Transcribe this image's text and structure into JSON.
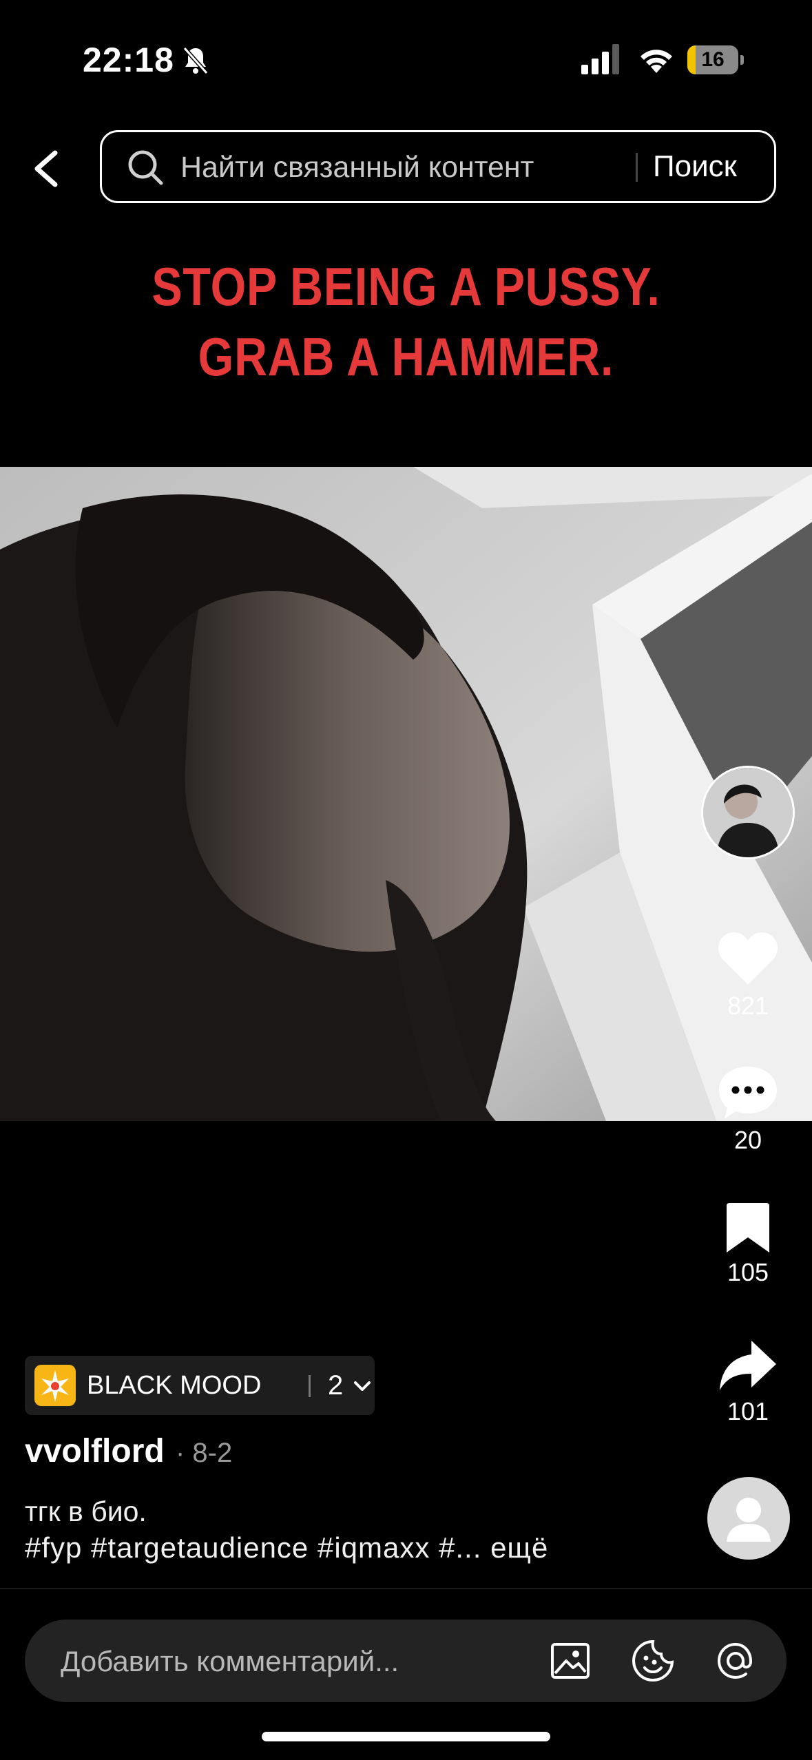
{
  "status": {
    "time": "22:18",
    "battery": "16",
    "battery_level": 0.16
  },
  "search": {
    "placeholder": "Найти связанный контент",
    "button": "Поиск"
  },
  "video": {
    "caption": "STOP BEING A PUSSY. GRAB A HAMMER."
  },
  "actions": {
    "likes": "821",
    "comments": "20",
    "saves": "105",
    "shares": "101"
  },
  "playlist": {
    "label": "BLACK MOOD",
    "count": "2"
  },
  "post": {
    "username": "vvolflord",
    "date": "· 8-2",
    "description_line1": "тгк в био.",
    "hashtags": "#fyp #targetaudience #iqmaxx #...",
    "more": "ещё"
  },
  "comment": {
    "placeholder": "Добавить комментарий..."
  },
  "colors": {
    "caption": "#e63a3a",
    "battery": "#f2c400",
    "playlist_icon": "#f7b516"
  }
}
